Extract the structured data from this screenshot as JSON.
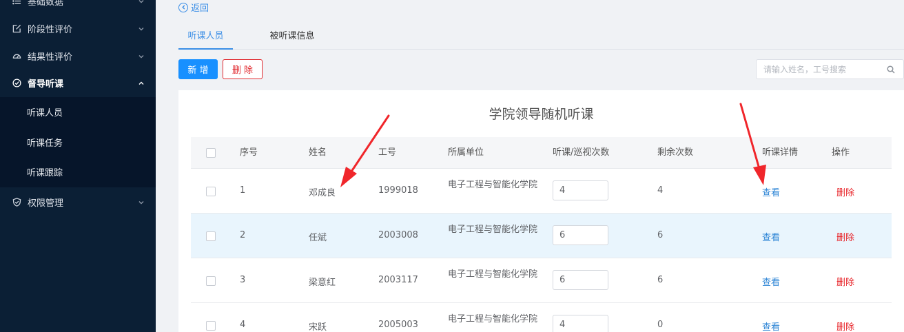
{
  "sidebar": {
    "items": [
      {
        "label": "基础数据",
        "icon": "list-icon"
      },
      {
        "label": "阶段性评价",
        "icon": "edit-icon"
      },
      {
        "label": "结果性评价",
        "icon": "gauge-icon"
      },
      {
        "label": "督导听课",
        "icon": "check-circle-icon"
      },
      {
        "label": "权限管理",
        "icon": "shield-icon"
      }
    ],
    "sub_items": [
      {
        "label": "听课人员"
      },
      {
        "label": "听课任务"
      },
      {
        "label": "听课跟踪"
      }
    ]
  },
  "header": {
    "back_label": "返回"
  },
  "tabs": [
    {
      "label": "听课人员"
    },
    {
      "label": "被听课信息"
    }
  ],
  "toolbar": {
    "add_label": "新 增",
    "delete_label": "删 除"
  },
  "search": {
    "placeholder": "请输入姓名，工号搜索"
  },
  "table": {
    "title": "学院领导随机听课",
    "columns": [
      "序号",
      "姓名",
      "工号",
      "所属单位",
      "听课/巡视次数",
      "剩余次数",
      "听课详情",
      "操作"
    ],
    "rows": [
      {
        "index": "1",
        "name": "邓成良",
        "id": "1999018",
        "unit": "电子工程与智能化学院",
        "count": "4",
        "remaining": "4",
        "view": "查看",
        "delete": "删除"
      },
      {
        "index": "2",
        "name": "任斌",
        "id": "2003008",
        "unit": "电子工程与智能化学院",
        "count": "6",
        "remaining": "6",
        "view": "查看",
        "delete": "删除"
      },
      {
        "index": "3",
        "name": "梁意红",
        "id": "2003117",
        "unit": "电子工程与智能化学院",
        "count": "6",
        "remaining": "6",
        "view": "查看",
        "delete": "删除"
      },
      {
        "index": "4",
        "name": "宋跃",
        "id": "2005003",
        "unit": "电子工程与智能化学院",
        "count": "4",
        "remaining": "0",
        "view": "查看",
        "delete": "删除"
      }
    ]
  },
  "colors": {
    "sidebar_bg": "#0b1f35",
    "accent": "#1890ff",
    "danger": "#e0262b",
    "link": "#2f86d6",
    "row_hover": "#e9f5fd"
  }
}
